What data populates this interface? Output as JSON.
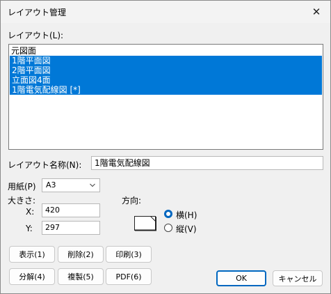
{
  "window": {
    "title": "レイアウト管理"
  },
  "layout_list": {
    "label": "レイアウト(L):",
    "items": [
      {
        "text": "元図面",
        "selected": false
      },
      {
        "text": "1階平面図",
        "selected": true
      },
      {
        "text": "2階平面図",
        "selected": true
      },
      {
        "text": "立面図4面",
        "selected": true
      },
      {
        "text": "1階電気配線図 [*]",
        "selected": true
      }
    ]
  },
  "layout_name": {
    "label": "レイアウト名称(N):",
    "value": "1階電気配線図"
  },
  "paper": {
    "label": "用紙(P)",
    "value": "A3"
  },
  "size": {
    "label": "大きさ:",
    "x_label": "X:",
    "x_value": "420",
    "y_label": "Y:",
    "y_value": "297"
  },
  "orientation": {
    "label": "方向:",
    "landscape_label": "横(H)",
    "portrait_label": "縦(V)",
    "selected": "landscape"
  },
  "buttons": {
    "show": "表示(1)",
    "delete": "削除(2)",
    "print": "印刷(3)",
    "split": "分解(4)",
    "duplicate": "複製(5)",
    "pdf": "PDF(6)",
    "ok": "OK",
    "cancel": "キャンセル"
  },
  "colors": {
    "selection": "#0078d7",
    "accent": "#0067c0"
  }
}
